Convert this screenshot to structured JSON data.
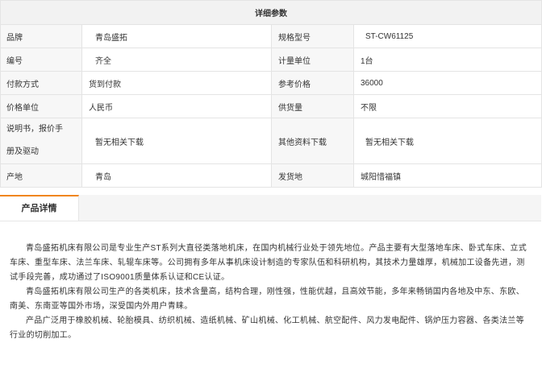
{
  "params": {
    "header": "详细参数",
    "rows": [
      {
        "k1": "品牌",
        "v1": "青岛盛拓",
        "k2": "规格型号",
        "v2": "ST-CW61125"
      },
      {
        "k1": "编号",
        "v1": "齐全",
        "k2": "计量单位",
        "v2": "1台"
      },
      {
        "k1": "付款方式",
        "v1": "货到付款",
        "k2": "参考价格",
        "v2": "36000"
      },
      {
        "k1": "价格单位",
        "v1": "人民币",
        "k2": "供货量",
        "v2": "不限"
      },
      {
        "k1_line1": "说明书，报价手",
        "k1_line2": "册及驱动",
        "v1": "暂无相关下载",
        "k2": "其他资料下载",
        "v2": "暂无相关下载"
      },
      {
        "k1": "产地",
        "v1": "青岛",
        "k2": "发货地",
        "v2": "城阳惜福镇"
      }
    ]
  },
  "tabs": {
    "active_label": "产品详情"
  },
  "detail": {
    "paragraphs": [
      "青岛盛拓机床有限公司是专业生产ST系列大直径类落地机床，在国内机械行业处于领先地位。产品主要有大型落地车床、卧式车床、立式车床、重型车床、法兰车床、轧辊车床等。公司拥有多年从事机床设计制造的专家队伍和科研机构，其技术力量雄厚，机械加工设备先进，测试手段完善，成功通过了ISO9001质量体系认证和CE认证。",
      "青岛盛拓机床有限公司生产的各类机床，技术含量高，结构合理，刚性强，性能优越，且高效节能，多年来畅销国内各地及中东、东欧、南美、东南亚等国外市场，深受国内外用户青睐。",
      "产品广泛用于橡胶机械、轮胎模具、纺织机械、造纸机械、矿山机械、化工机械、航空配件、风力发电配件、锅炉压力容器、各类法兰等行业的切削加工。"
    ]
  }
}
